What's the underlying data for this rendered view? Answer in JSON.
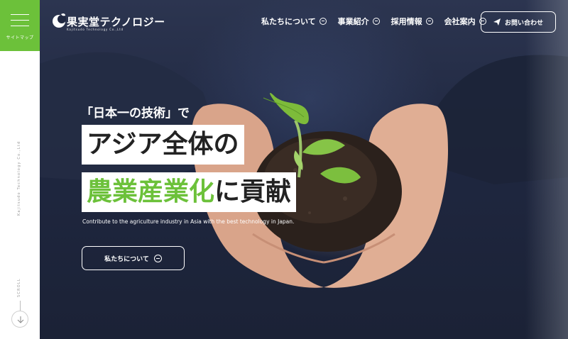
{
  "rail": {
    "menu_label": "サイトマップ",
    "company_vertical": "Kajitsudo Technology Co.,Ltd",
    "scroll_label": "SCROLL"
  },
  "header": {
    "logo_name": "果実堂テクノロジー",
    "logo_sub": "Kajitsudo Technology Co.,Ltd",
    "nav": [
      {
        "label": "私たちについて"
      },
      {
        "label": "事業紹介"
      },
      {
        "label": "採用情報"
      },
      {
        "label": "会社案内"
      }
    ],
    "contact_label": "お問い合わせ"
  },
  "hero": {
    "tagline": "「日本一の技術」で",
    "headline_line1": "アジア全体の",
    "headline_line2_green": "農業産業化",
    "headline_line2_dark": "に貢献",
    "subcopy": "Contribute to the agriculture industry in Asia with the best technology in Japan.",
    "cta_label": "私たちについて"
  },
  "colors": {
    "accent_green": "#6cc13a",
    "text_dark": "#222222",
    "hero_navy": "#1f2740"
  },
  "icons": [
    "menu-icon",
    "arrow-down-icon",
    "leaf-logo-icon",
    "circle-arrow-icon",
    "paper-plane-icon"
  ]
}
